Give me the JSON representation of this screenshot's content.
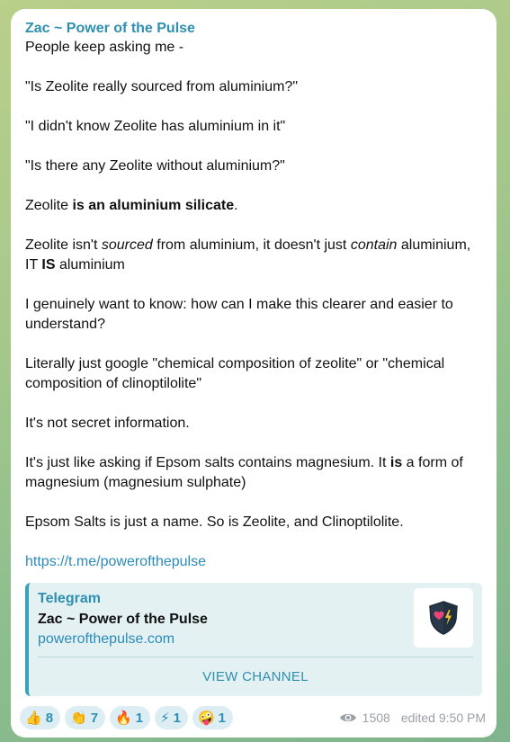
{
  "message": {
    "sender": "Zac ~ Power of the Pulse",
    "paragraphs": [
      [
        {
          "t": "People keep asking me -"
        }
      ],
      [
        {
          "t": "\"Is Zeolite really sourced from aluminium?\""
        }
      ],
      [
        {
          "t": "\"I didn't know Zeolite has aluminium in it\""
        }
      ],
      [
        {
          "t": "\"Is there any Zeolite without aluminium?\""
        }
      ],
      [
        {
          "t": "Zeolite "
        },
        {
          "t": "is an aluminium silicate",
          "b": true
        },
        {
          "t": "."
        }
      ],
      [
        {
          "t": "Zeolite isn't "
        },
        {
          "t": "sourced",
          "i": true
        },
        {
          "t": " from aluminium, it doesn't just "
        },
        {
          "t": "contain",
          "i": true
        },
        {
          "t": " aluminium, IT "
        },
        {
          "t": "IS",
          "b": true
        },
        {
          "t": " aluminium"
        }
      ],
      [
        {
          "t": "I genuinely want to know: how can I make this clearer and easier to understand?"
        }
      ],
      [
        {
          "t": "Literally just google \"chemical composition of zeolite\" or \"chemical composition of clinoptilolite\""
        }
      ],
      [
        {
          "t": "It's not secret information."
        }
      ],
      [
        {
          "t": "It's just like asking if Epsom salts contains magnesium. It "
        },
        {
          "t": "is",
          "b": true
        },
        {
          "t": " a form of magnesium (magnesium sulphate)"
        }
      ],
      [
        {
          "t": "Epsom Salts is just a name. So is Zeolite, and Clinoptilolite."
        }
      ]
    ],
    "link": "https://t.me/powerofthepulse"
  },
  "preview": {
    "site": "Telegram",
    "title": "Zac ~ Power of the Pulse",
    "domain": "powerofthepulse.com",
    "button": "VIEW CHANNEL",
    "thumb_icon": "shield-heart-lightning-icon"
  },
  "reactions": [
    {
      "emoji": "👍",
      "icon": "thumbs-up-icon",
      "count": "8"
    },
    {
      "emoji": "👏",
      "icon": "clapping-hands-icon",
      "count": "7"
    },
    {
      "emoji": "🔥",
      "icon": "fire-icon",
      "count": "1"
    },
    {
      "emoji": "⚡",
      "icon": "lightning-icon",
      "count": "1"
    },
    {
      "emoji": "🤪",
      "icon": "zany-face-icon",
      "count": "1"
    }
  ],
  "meta": {
    "views": "1508",
    "edited": "edited 9:50 PM"
  },
  "colors": {
    "accent": "#2f8fb0",
    "link": "#2b8bb8",
    "reaction_bg": "#dcedf3",
    "preview_bg": "#e4f1f2"
  }
}
